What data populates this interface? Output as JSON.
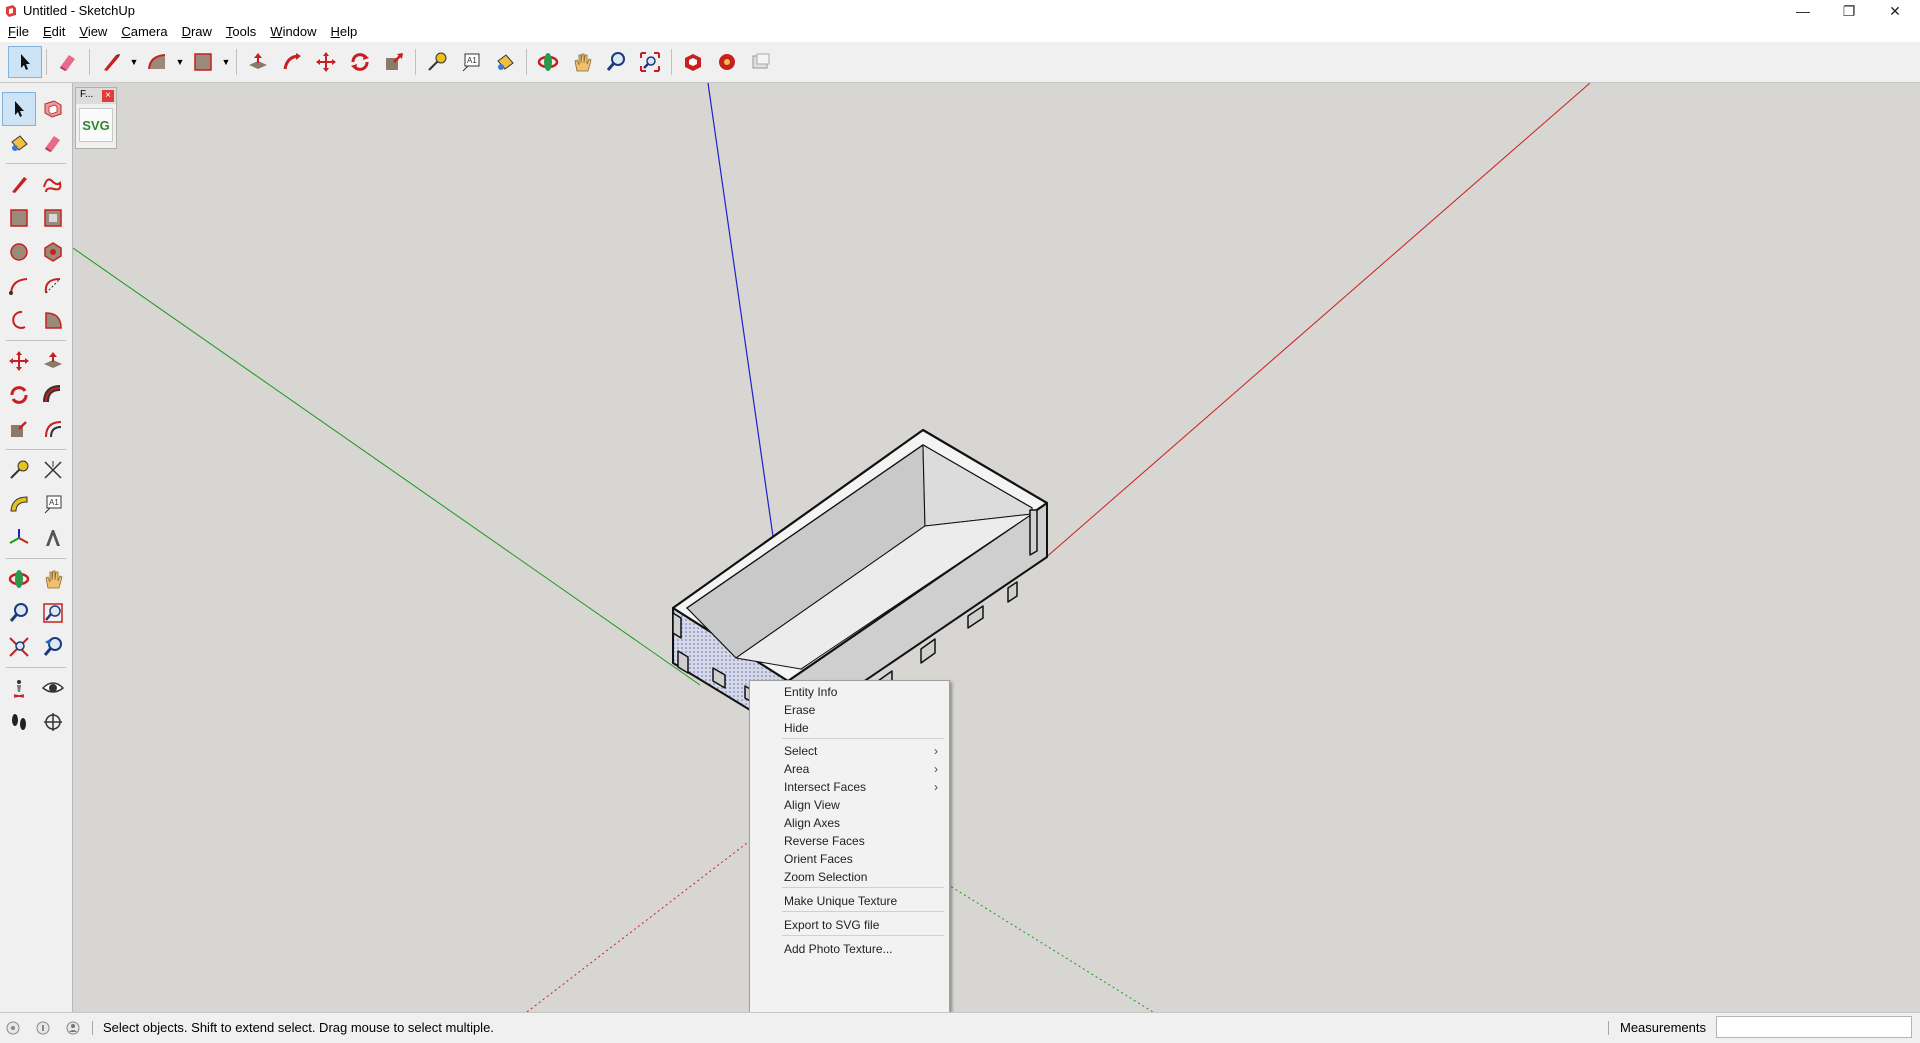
{
  "window": {
    "title": "Untitled - SketchUp",
    "minimize_glyph": "—",
    "restore_glyph": "❐",
    "close_glyph": "✕"
  },
  "menubar": [
    {
      "label": "File",
      "accel": "F",
      "rest": "ile"
    },
    {
      "label": "Edit",
      "accel": "E",
      "rest": "dit"
    },
    {
      "label": "View",
      "accel": "V",
      "rest": "iew"
    },
    {
      "label": "Camera",
      "accel": "C",
      "rest": "amera"
    },
    {
      "label": "Draw",
      "accel": "D",
      "rest": "raw"
    },
    {
      "label": "Tools",
      "accel": "T",
      "rest": "ools"
    },
    {
      "label": "Window",
      "accel": "W",
      "rest": "indow"
    },
    {
      "label": "Help",
      "accel": "H",
      "rest": "elp"
    }
  ],
  "toolbar_icons": [
    "select-icon",
    "eraser-icon",
    "line-icon",
    "arc-icon",
    "rectangle-icon",
    "push-pull-icon",
    "follow-me-icon",
    "move-icon",
    "rotate-icon",
    "scale-icon",
    "tape-measure-icon",
    "text-icon",
    "paint-bucket-icon",
    "orbit-icon",
    "pan-icon",
    "zoom-icon",
    "zoom-extents-icon",
    "warehouse-icon",
    "extension-warehouse-icon",
    "layout-icon"
  ],
  "floating_panel": {
    "title": "F...",
    "button_label": "SVG",
    "close_glyph": "×"
  },
  "context_menu": {
    "items": [
      {
        "label": "Entity Info",
        "submenu": false
      },
      {
        "label": "Erase",
        "submenu": false
      },
      {
        "label": "Hide",
        "submenu": false
      },
      {
        "label": "Select",
        "submenu": true
      },
      {
        "label": "Area",
        "submenu": true
      },
      {
        "label": "Intersect Faces",
        "submenu": true
      },
      {
        "label": "Align View",
        "submenu": false
      },
      {
        "label": "Align Axes",
        "submenu": false
      },
      {
        "label": "Reverse Faces",
        "submenu": false
      },
      {
        "label": "Orient Faces",
        "submenu": false
      },
      {
        "label": "Zoom Selection",
        "submenu": false
      },
      {
        "label": "Make Unique Texture",
        "submenu": false
      },
      {
        "label": "Export to SVG file",
        "submenu": false
      },
      {
        "label": "Add Photo Texture...",
        "submenu": false
      }
    ],
    "submenu_glyph": "›"
  },
  "statusbar": {
    "hint": "Select objects. Shift to extend select. Drag mouse to select multiple.",
    "measurements_label": "Measurements",
    "measurements_value": ""
  },
  "colors": {
    "viewport_bg": "#d8d6d2",
    "axis_red": "#cc2020",
    "axis_green": "#1a9a1a",
    "axis_blue": "#2020cc",
    "selection_blue": "#cde4f7"
  }
}
